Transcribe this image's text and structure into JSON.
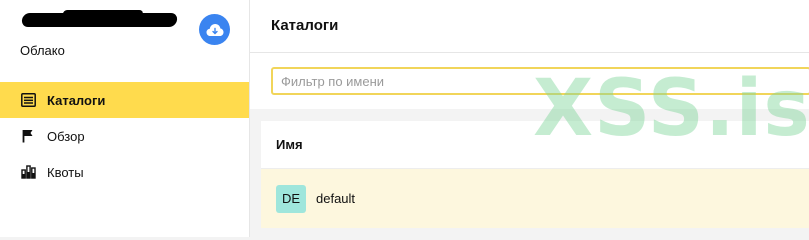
{
  "sidebar": {
    "account_label": "Облако",
    "cloud_button_icon": "cloud-icon",
    "items": [
      {
        "label": "Каталоги",
        "icon": "catalog-icon",
        "active": true
      },
      {
        "label": "Обзор",
        "icon": "flag-icon",
        "active": false
      },
      {
        "label": "Квоты",
        "icon": "quota-icon",
        "active": false
      }
    ]
  },
  "header": {
    "title": "Каталоги"
  },
  "filter": {
    "placeholder": "Фильтр по имени",
    "value": ""
  },
  "table": {
    "columns": [
      "Имя"
    ],
    "rows": [
      {
        "badge": "DE",
        "name": "default"
      }
    ]
  },
  "watermark": "XSS.is",
  "colors": {
    "accent": "#ffdb4d",
    "cloud_button": "#3a84f0",
    "badge": "#9fe6dc",
    "row_highlight": "#fdf7de"
  }
}
